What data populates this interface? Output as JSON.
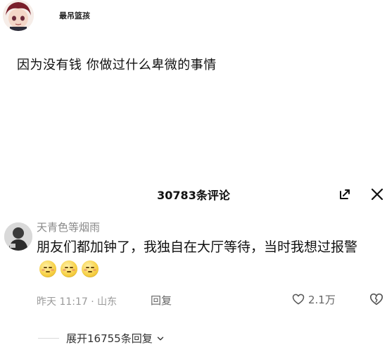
{
  "post": {
    "author_name": "最吊篮孩",
    "title": "因为没有钱 你做过什么卑微的事情"
  },
  "comments_panel": {
    "count_label": "30783条评论",
    "icons": {
      "collapse": "collapse-icon",
      "close": "close-icon"
    }
  },
  "comment": {
    "author": "天青色等烟雨",
    "text": "朋友们都加钟了，我独自在大厅等待，当时我想过报警",
    "emoji_count": 3,
    "meta": "昨天 11:17 · 山东",
    "reply_label": "回复",
    "like_count": "2.1万",
    "icons": {
      "like": "heart-icon",
      "dislike": "broken-heart-icon",
      "emoji": "embarrassed-emoji-icon"
    }
  },
  "expand": {
    "label": "展开16755条回复",
    "icon": "chevron-down-icon"
  },
  "colors": {
    "meta_gray": "#9a9a9a",
    "name_gray": "#8a8a8a",
    "text_dark": "#111111"
  }
}
